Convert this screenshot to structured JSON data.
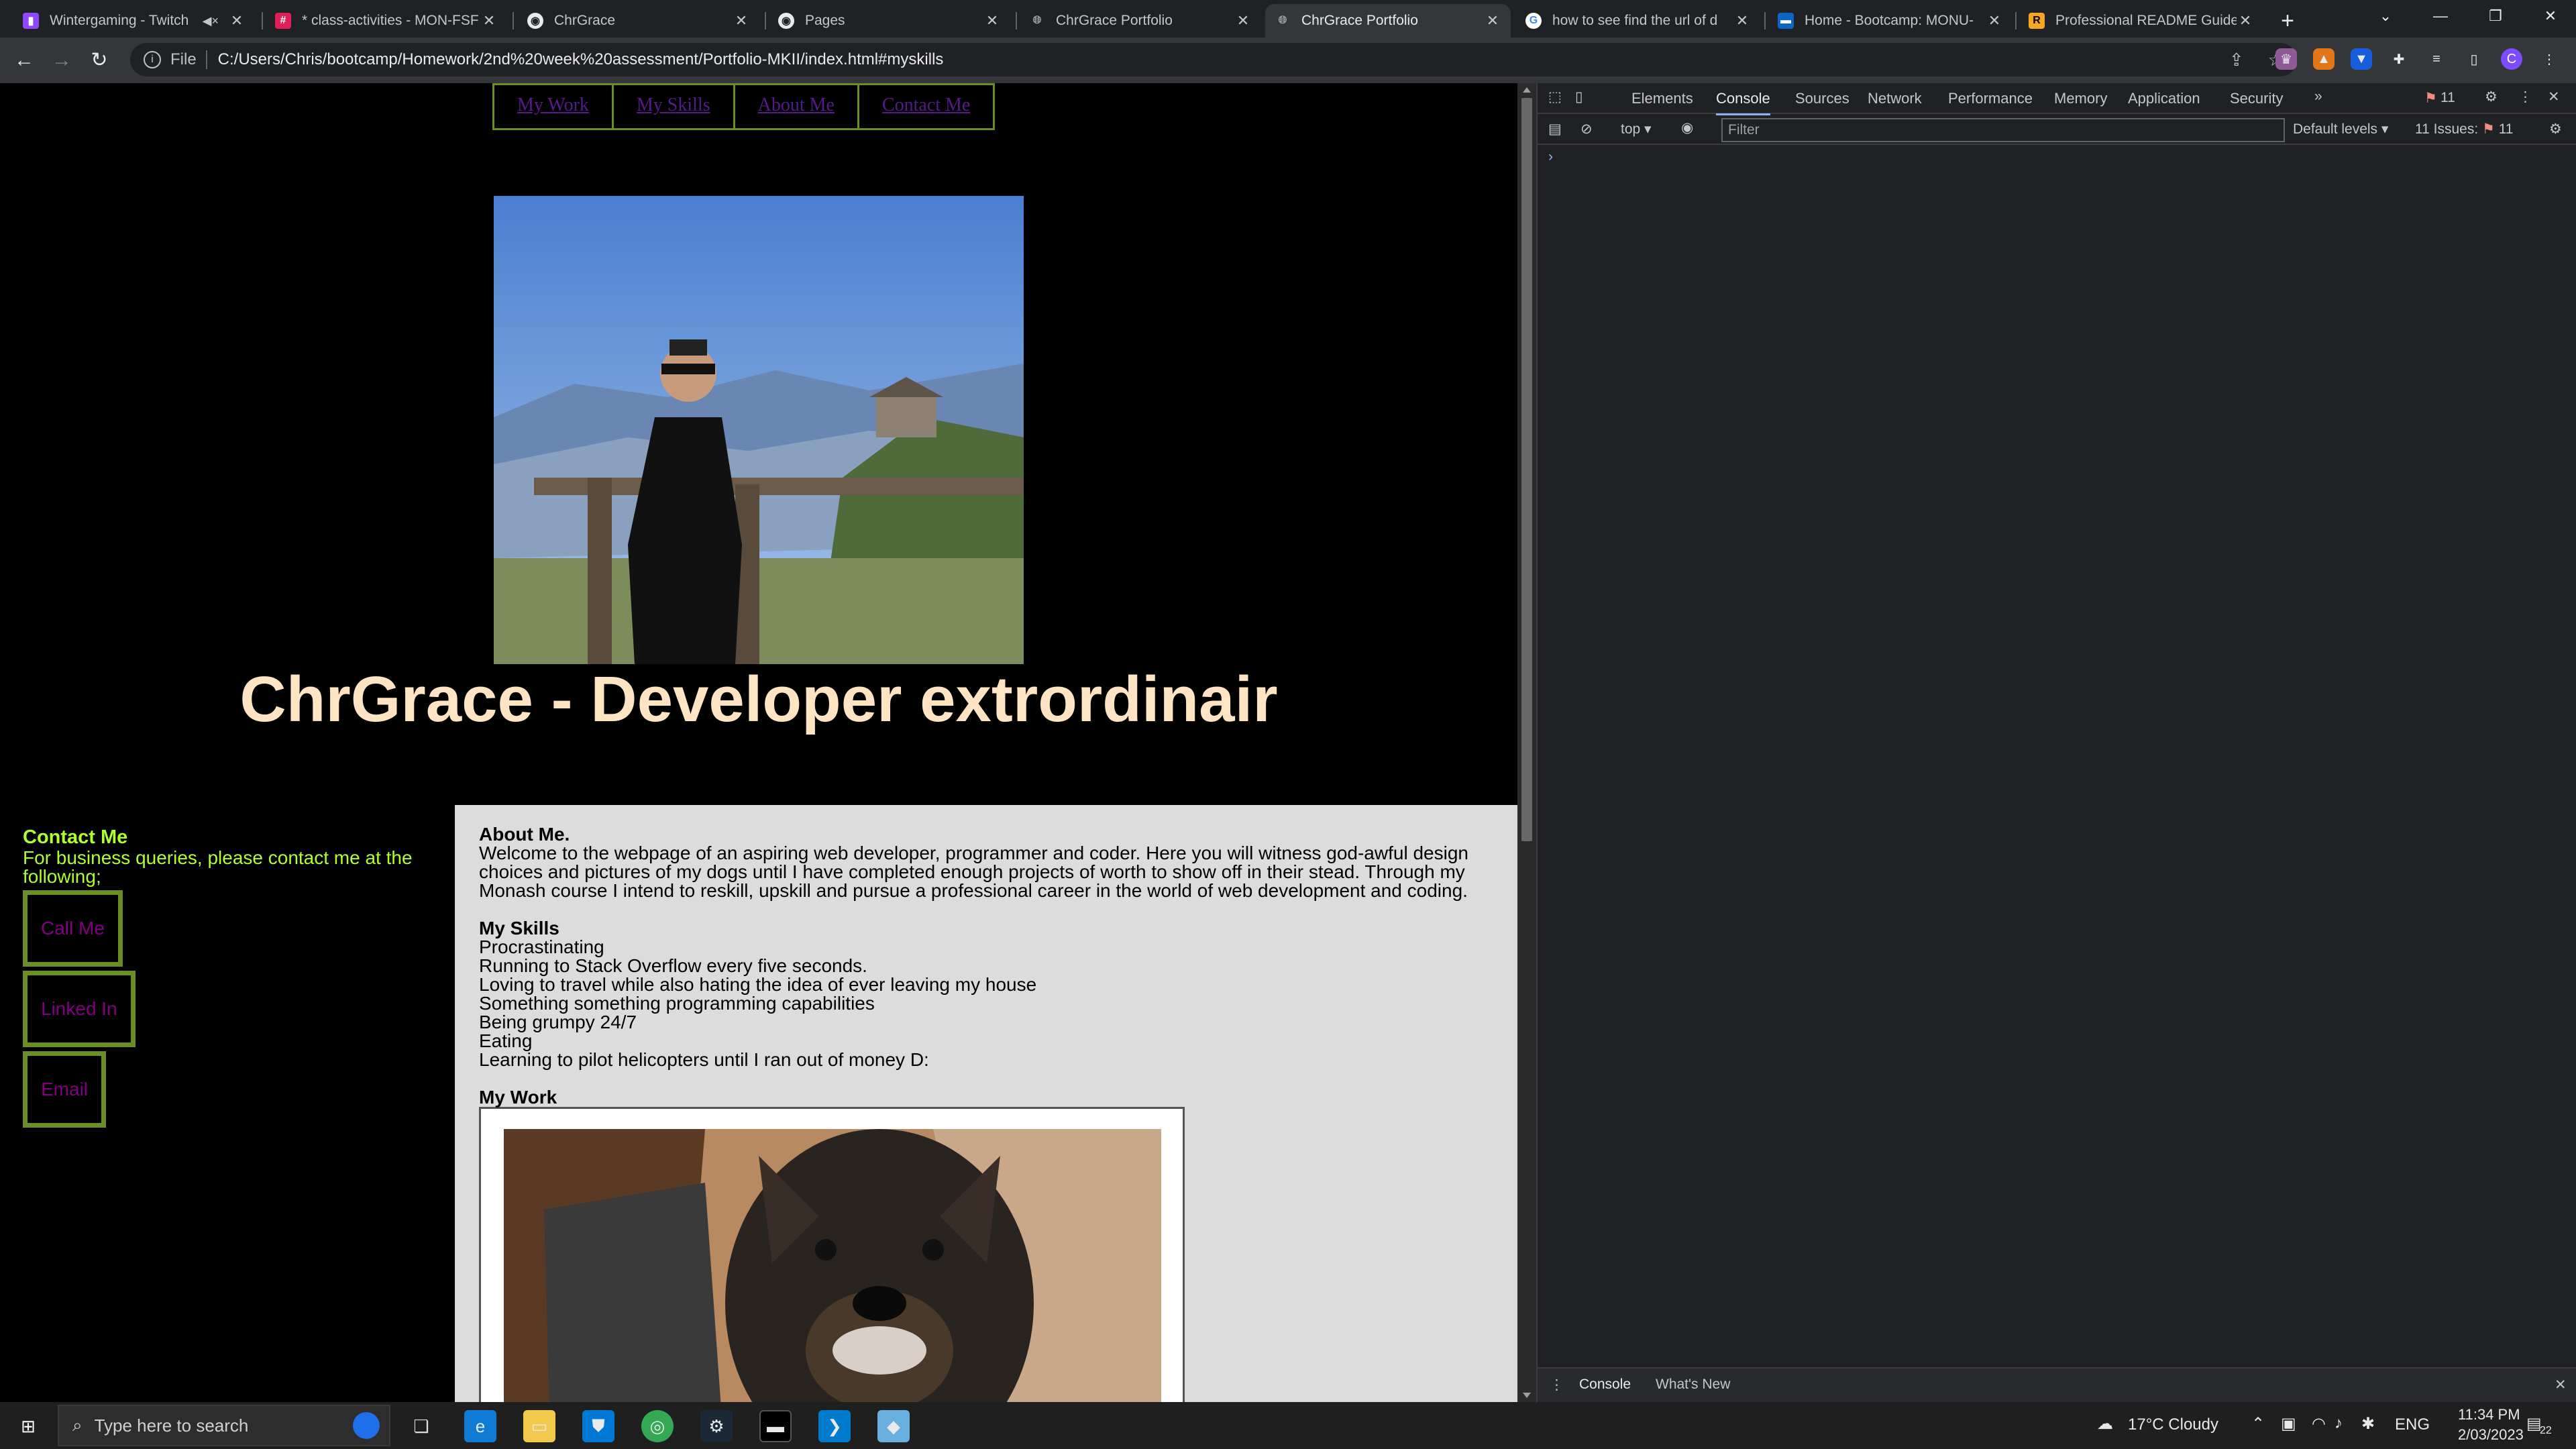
{
  "browser": {
    "tabs": [
      {
        "title": "Wintergaming - Twitch",
        "icon": "twitch-icon",
        "color": "#9146ff",
        "muted": true
      },
      {
        "title": "* class-activities - MON-FSF",
        "icon": "slack-icon",
        "color": "#e01e5a"
      },
      {
        "title": "ChrGrace",
        "icon": "github-icon",
        "color": "#e8eaed"
      },
      {
        "title": "Pages",
        "icon": "github-icon",
        "color": "#e8eaed"
      },
      {
        "title": "ChrGrace Portfolio",
        "icon": "globe-icon",
        "color": "#9aa0a6"
      },
      {
        "title": "ChrGrace Portfolio",
        "icon": "globe-icon",
        "color": "#9aa0a6",
        "active": true
      },
      {
        "title": "how to see find the url of d",
        "icon": "google-icon",
        "color": "#4285f4"
      },
      {
        "title": "Home - Bootcamp: MONU-",
        "icon": "bootcamp-icon",
        "color": "#0a66c2"
      },
      {
        "title": "Professional README Guide",
        "icon": "readme-icon",
        "color": "#f5a623"
      }
    ],
    "address": {
      "scheme": "File",
      "url": "C:/Users/Chris/bootcamp/Homework/2nd%20week%20assessment/Portfolio-MKII/index.html#myskills"
    },
    "profile_initial": "C"
  },
  "page": {
    "nav": [
      "My Work",
      "My Skills",
      "About Me",
      "Contact Me"
    ],
    "hero_title": "ChrGrace - Developer extrordinair",
    "contact": {
      "heading": "Contact Me",
      "text": "For business queries, please contact me at the following;",
      "buttons": [
        "Call Me",
        "Linked In",
        "Email"
      ]
    },
    "about": {
      "heading": "About Me.",
      "text": "Welcome to the webpage of an aspiring web developer, programmer and coder. Here you will witness god-awful design choices and pictures of my dogs until I have completed enough projects of worth to show off in their stead. Through my Monash course I intend to reskill, upskill and pursue a professional career in the world of web development and coding."
    },
    "skills": {
      "heading": "My Skills",
      "items": [
        "Procrastinating",
        "Running to Stack Overflow every five seconds.",
        "Loving to travel while also hating the idea of ever leaving my house",
        "Something something programming capabilities",
        "Being grumpy 24/7",
        "Eating",
        "Learning to pilot helicopters until I ran out of money D:"
      ]
    },
    "work": {
      "heading": "My Work"
    },
    "colors": {
      "nav_border": "#6b8e23",
      "link": "#551a8b",
      "hero": "#ffe4c4",
      "contact_text": "#adff2f"
    }
  },
  "devtools": {
    "tabs": [
      "Elements",
      "Console",
      "Sources",
      "Network",
      "Performance",
      "Memory",
      "Application",
      "Security"
    ],
    "active_tab": "Console",
    "error_count": "11",
    "context": "top",
    "filter_placeholder": "Filter",
    "levels": "Default levels",
    "issues": "11 Issues:",
    "issues_count": "11",
    "drawer_tabs": [
      "Console",
      "What's New"
    ]
  },
  "taskbar": {
    "search_placeholder": "Type here to search",
    "weather": "17°C  Cloudy",
    "language": "ENG",
    "time": "11:34 PM",
    "date": "2/03/2023",
    "notifications": "22"
  }
}
